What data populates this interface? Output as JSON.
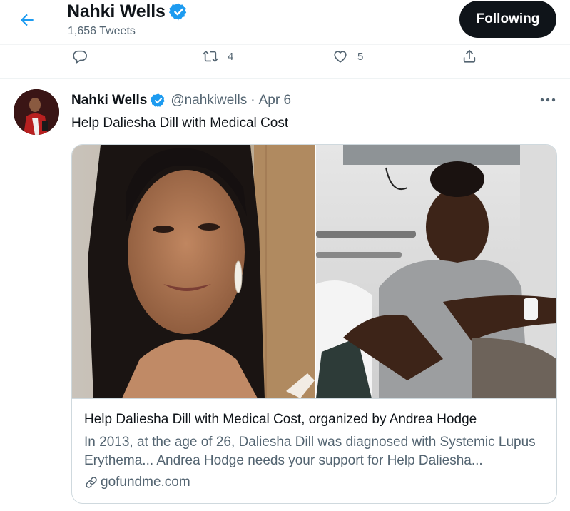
{
  "header": {
    "back_icon": "arrow-left-icon",
    "name": "Nahki Wells",
    "verified_icon": "verified-badge-icon",
    "tweet_count": "1,656 Tweets",
    "follow_label": "Following"
  },
  "prev_actions": {
    "reply_icon": "reply-icon",
    "retweet_icon": "retweet-icon",
    "retweet_count": "4",
    "like_icon": "heart-icon",
    "like_count": "5",
    "share_icon": "share-icon"
  },
  "tweet": {
    "avatar_icon": "avatar",
    "name": "Nahki Wells",
    "handle": "@nahkiwells",
    "separator": "·",
    "date": "Apr 6",
    "more_icon": "more-icon",
    "text": "Help Daliesha Dill with Medical Cost",
    "card": {
      "title": "Help Daliesha Dill with Medical Cost, organized by Andrea Hodge",
      "description": "In 2013, at the age of 26, Daliesha Dill was diagnosed with Systemic Lupus Erythema... Andrea Hodge needs your support for Help Daliesha...",
      "domain": "gofundme.com",
      "link_icon": "link-icon"
    }
  },
  "colors": {
    "accent": "#1d9bf0",
    "text": "#0f1419",
    "secondary": "#536471",
    "border": "#cfd9de",
    "button_bg": "#0f1419"
  }
}
